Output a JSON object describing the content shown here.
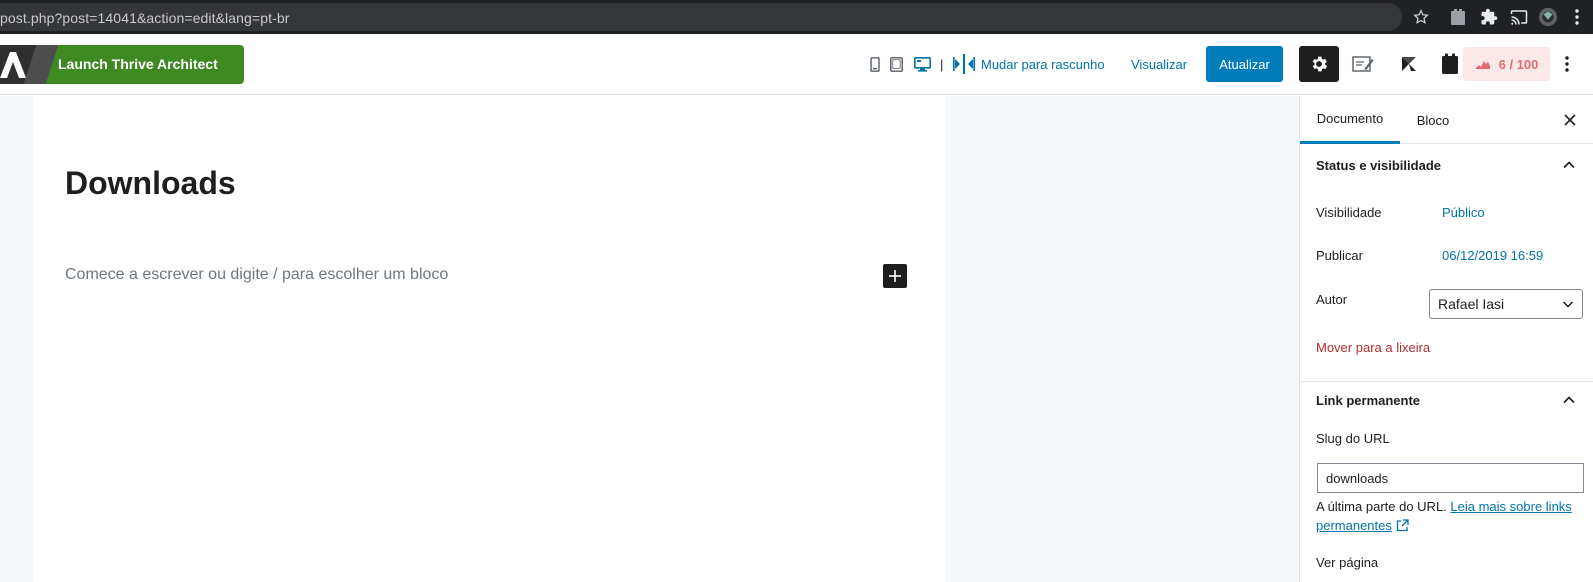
{
  "browser": {
    "url": "post.php?post=14041&action=edit&lang=pt-br",
    "icons": [
      "star-icon",
      "extension-puzzle-icon",
      "extension-icon",
      "cast-icon",
      "profile-avatar-icon",
      "chrome-menu-icon"
    ]
  },
  "toolbar": {
    "thrive_label": "Launch Thrive Architect",
    "separator": "|",
    "draft_label": "Mudar para rascunho",
    "preview_label": "Visualizar",
    "update_label": "Atualizar",
    "score_label": "6 / 100",
    "device_icons": [
      "mobile-preview-icon",
      "tablet-preview-icon",
      "desktop-preview-icon"
    ]
  },
  "editor": {
    "title": "Downloads",
    "placeholder": "Comece a escrever ou digite / para escolher um bloco"
  },
  "sidebar": {
    "tabs": [
      {
        "label": "Documento",
        "active": true
      },
      {
        "label": "Bloco",
        "active": false
      }
    ],
    "status_panel": {
      "title": "Status e visibilidade",
      "visibility_label": "Visibilidade",
      "visibility_value": "Público",
      "publish_label": "Publicar",
      "publish_value": "06/12/2019 16:59",
      "author_label": "Autor",
      "author_value": "Rafael Iasi",
      "trash_label": "Mover para a lixeira"
    },
    "permalink_panel": {
      "title": "Link permanente",
      "slug_label": "Slug do URL",
      "slug_value": "downloads",
      "help_text": "A última parte do URL. ",
      "help_link": "Leia mais sobre links permanentes",
      "view_page_label": "Ver página"
    }
  },
  "colors": {
    "accent": "#007cba",
    "link": "#0073aa",
    "thrive_green": "#3d8a22",
    "danger": "#b32d2e",
    "score_bg": "#fbe9ea",
    "score_text": "#e26a6f"
  }
}
